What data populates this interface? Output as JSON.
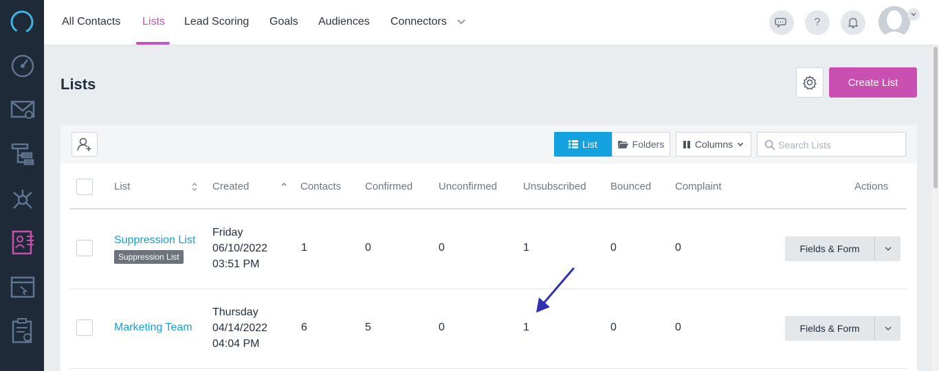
{
  "nav": {
    "items": [
      {
        "label": "All Contacts"
      },
      {
        "label": "Lists"
      },
      {
        "label": "Lead Scoring"
      },
      {
        "label": "Goals"
      },
      {
        "label": "Audiences"
      },
      {
        "label": "Connectors"
      }
    ],
    "help_label": "?"
  },
  "page": {
    "title": "Lists",
    "create_label": "Create List"
  },
  "toolbar": {
    "list_label": "List",
    "folders_label": "Folders",
    "columns_label": "Columns",
    "search_placeholder": "Search Lists"
  },
  "table": {
    "headers": [
      "List",
      "Created",
      "Contacts",
      "Confirmed",
      "Unconfirmed",
      "Unsubscribed",
      "Bounced",
      "Complaint",
      "Actions"
    ],
    "rows": [
      {
        "name": "Suppression List",
        "tag": "Suppression List",
        "created_day": "Friday",
        "created_date": "06/10/2022",
        "created_time": "03:51 PM",
        "contacts": "1",
        "confirmed": "0",
        "unconfirmed": "0",
        "unsubscribed": "1",
        "bounced": "0",
        "complaint": "0",
        "action_label": "Fields & Form"
      },
      {
        "name": "Marketing Team",
        "created_day": "Thursday",
        "created_date": "04/14/2022",
        "created_time": "04:04 PM",
        "contacts": "6",
        "confirmed": "5",
        "unconfirmed": "0",
        "unsubscribed": "1",
        "bounced": "0",
        "complaint": "0",
        "action_label": "Fields & Form"
      }
    ]
  },
  "colors": {
    "accent": "#c94fb0",
    "link": "#139fd6",
    "sidebar": "#1e2a38",
    "annotation_arrow": "#2f2fb0"
  }
}
